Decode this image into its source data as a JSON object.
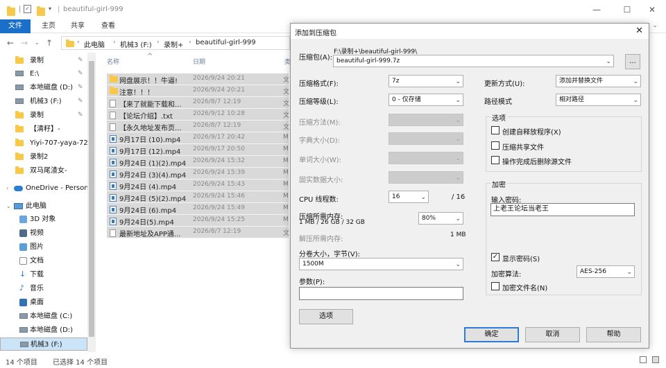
{
  "explorer": {
    "title": "beautiful-girl-999",
    "ribbon_tabs": [
      "文件",
      "主页",
      "共享",
      "查看"
    ],
    "address": {
      "crumbs": [
        "此电脑",
        "机械3 (F:)",
        "录制+",
        "beautiful-girl-999"
      ]
    },
    "sidebar": [
      {
        "label": "录制",
        "pinned": true
      },
      {
        "label": "E:\\",
        "pinned": true
      },
      {
        "label": "本地磁盘 (D:)",
        "pinned": true
      },
      {
        "label": "机械3 (F:)",
        "pinned": true
      },
      {
        "label": "录制",
        "pinned": true
      },
      {
        "label": "【清籽】-",
        "pinned": false
      },
      {
        "label": "Yiyi-707-yaya-72",
        "pinned": false
      },
      {
        "label": "录制2",
        "pinned": false
      },
      {
        "label": "双马尾渣女-",
        "pinned": false
      },
      {
        "label": "OneDrive - Person",
        "pinned": false
      },
      {
        "label": "此电脑",
        "pinned": false
      },
      {
        "label": "3D 对象",
        "pinned": false
      },
      {
        "label": "视频",
        "pinned": false
      },
      {
        "label": "图片",
        "pinned": false
      },
      {
        "label": "文档",
        "pinned": false
      },
      {
        "label": "下载",
        "pinned": false
      },
      {
        "label": "音乐",
        "pinned": false
      },
      {
        "label": "桌面",
        "pinned": false
      },
      {
        "label": "本地磁盘 (C:)",
        "pinned": false
      },
      {
        "label": "本地磁盘 (D:)",
        "pinned": false
      },
      {
        "label": "机械3 (F:)",
        "pinned": false
      }
    ],
    "columns": {
      "name": "名称",
      "date": "日期",
      "type": "类"
    },
    "files": [
      {
        "name": "网盘展示！！牛逼!",
        "date": "2026/9/24 20:21",
        "type": "文",
        "kind": "folder"
      },
      {
        "name": "注意！！！",
        "date": "2026/9/24 20:21",
        "type": "文",
        "kind": "folder"
      },
      {
        "name": "【来了就能下载和...",
        "date": "2026/8/7 12:19",
        "type": "文",
        "kind": "txt"
      },
      {
        "name": "【论坛介绍】.txt",
        "date": "2026/9/12 10:28",
        "type": "文",
        "kind": "txt"
      },
      {
        "name": "【永久地址发布页...",
        "date": "2026/8/7 12:19",
        "type": "文",
        "kind": "txt"
      },
      {
        "name": "9月17日 (10).mp4",
        "date": "2026/9/17 20:42",
        "type": "M",
        "kind": "mp4"
      },
      {
        "name": "9月17日 (12).mp4",
        "date": "2026/9/17 20:50",
        "type": "M",
        "kind": "mp4"
      },
      {
        "name": "9月24日 (1)(2).mp4",
        "date": "2026/9/24 15:32",
        "type": "M",
        "kind": "mp4"
      },
      {
        "name": "9月24日 (3)(4).mp4",
        "date": "2026/9/24 15:39",
        "type": "M",
        "kind": "mp4"
      },
      {
        "name": "9月24日 (4).mp4",
        "date": "2026/9/24 15:43",
        "type": "M",
        "kind": "mp4"
      },
      {
        "name": "9月24日 (5)(2).mp4",
        "date": "2026/9/24 15:46",
        "type": "M",
        "kind": "mp4"
      },
      {
        "name": "9月24日 (6).mp4",
        "date": "2026/9/24 15:49",
        "type": "M",
        "kind": "mp4"
      },
      {
        "name": "9月24日(5).mp4",
        "date": "2026/9/24 15:25",
        "type": "M",
        "kind": "mp4"
      },
      {
        "name": "最新地址及APP通...",
        "date": "2026/8/7 12:19",
        "type": "文",
        "kind": "txt"
      }
    ],
    "status": {
      "count": "14 个项目",
      "selected": "已选择 14 个项目"
    }
  },
  "dialog": {
    "title": "添加到压缩包",
    "archive_label": "压缩包(A):",
    "archive_path": "F:\\录制+\\beautiful-girl-999\\",
    "archive_name": "beautiful-girl-999.7z",
    "browse_label": "...",
    "format_label": "压缩格式(F):",
    "format_value": "7z",
    "level_label": "压缩等级(L):",
    "level_value": "0 - 仅存储",
    "method_label": "压缩方法(M):",
    "dict_label": "字典大小(D):",
    "word_label": "单词大小(W):",
    "solid_label": "固实数据大小:",
    "threads_label": "CPU 线程数:",
    "threads_value": "16",
    "threads_max": "/ 16",
    "mem_comp_label": "压缩所需内存:",
    "mem_comp_value": "1 MB / 26 GB / 32 GB",
    "mem_pct": "80%",
    "mem_decomp_label": "解压所需内存:",
    "mem_decomp_value": "1 MB",
    "volume_label": "分卷大小，字节(V):",
    "volume_value": "1500M",
    "params_label": "参数(P):",
    "params_value": "",
    "options_button": "选项",
    "update_label": "更新方式(U):",
    "update_value": "添加并替换文件",
    "path_label": "路径模式",
    "path_value": "相对路径",
    "options_group": "选项",
    "opt_sfx": "创建自释放程序(X)",
    "opt_shared": "压缩共享文件",
    "opt_delete": "操作完成后删除源文件",
    "encrypt_group": "加密",
    "password_label": "输入密码:",
    "password_value": "上老王论坛当老王",
    "show_password": "显示密码(S)",
    "enc_method_label": "加密算法:",
    "enc_method_value": "AES-256",
    "encrypt_names": "加密文件名(N)",
    "ok": "确定",
    "cancel": "取消",
    "help": "帮助"
  }
}
